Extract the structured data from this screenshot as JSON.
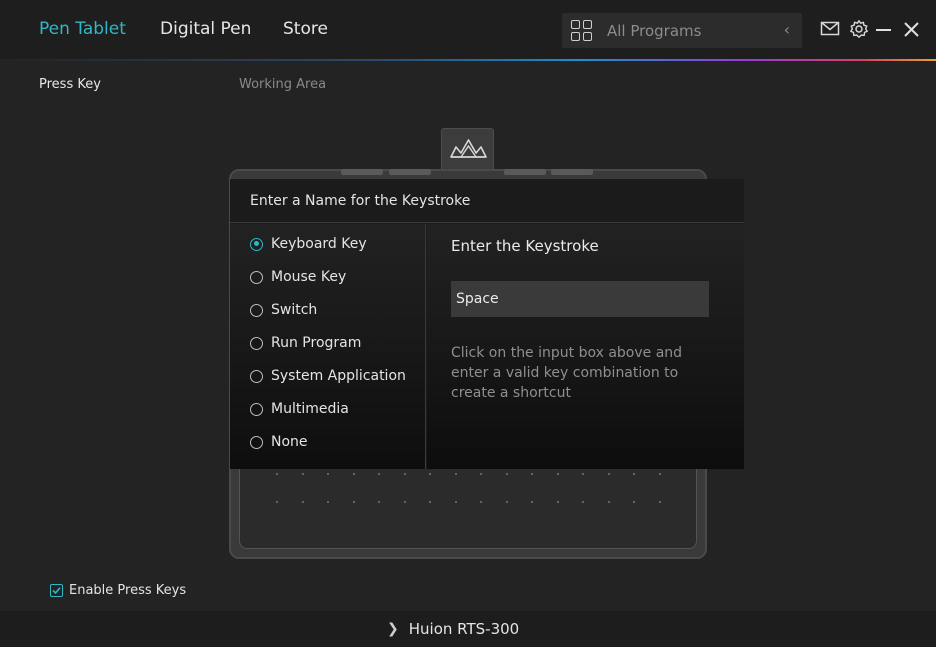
{
  "nav": {
    "tabs": [
      {
        "label": "Pen Tablet",
        "active": true
      },
      {
        "label": "Digital Pen",
        "active": false
      },
      {
        "label": "Store",
        "active": false
      }
    ],
    "program_selector": {
      "label": "All Programs",
      "icon": "grid-icon"
    },
    "icons": [
      "mail-icon",
      "gear-icon",
      "minimize-icon",
      "close-icon"
    ],
    "accent_color": "#2fb7c6"
  },
  "subtabs": [
    {
      "label": "Press Key",
      "active": true
    },
    {
      "label": "Working Area",
      "active": false
    }
  ],
  "dialog": {
    "title": "Enter a Name for the Keystroke",
    "options": [
      {
        "label": "Keyboard Key",
        "checked": true
      },
      {
        "label": "Mouse Key",
        "checked": false
      },
      {
        "label": "Switch",
        "checked": false
      },
      {
        "label": "Run Program",
        "checked": false
      },
      {
        "label": "System Application",
        "checked": false
      },
      {
        "label": "Multimedia",
        "checked": false
      },
      {
        "label": "None",
        "checked": false
      }
    ],
    "keystroke_title": "Enter the Keystroke",
    "keystroke_value": "Space",
    "help_text": "Click on the input box above and enter a valid key combination to create a shortcut"
  },
  "enable_press_keys": {
    "label": "Enable Press Keys",
    "checked": true
  },
  "footer": {
    "device_name": "Huion RTS-300"
  }
}
